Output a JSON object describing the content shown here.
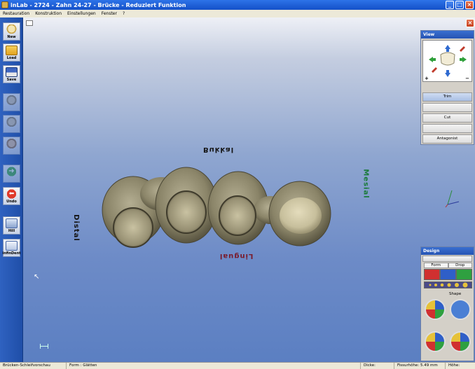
{
  "window": {
    "title": "inLab - 2724 - Zahn 24-27 - Brücke - Reduziert Funktion",
    "controls": [
      "_",
      "□",
      "×"
    ]
  },
  "menu": [
    "Restauration",
    "Konstruktion",
    "Einstellungen",
    "Fenster",
    "?"
  ],
  "toolbar": [
    {
      "label": "New",
      "icon": "tooth-new-icon"
    },
    {
      "label": "Load",
      "icon": "folder-icon"
    },
    {
      "label": "Save",
      "icon": "floppy-icon"
    },
    {
      "label": "",
      "icon": "tooth-step1-icon"
    },
    {
      "label": "",
      "icon": "tooth-step2-icon"
    },
    {
      "label": "",
      "icon": "tooth-step3-icon"
    },
    {
      "label": "",
      "icon": "arrow-right-icon"
    },
    {
      "label": "Undo",
      "icon": "undo-icon"
    },
    {
      "label": "Hill",
      "icon": "hill-icon"
    },
    {
      "label": "infinDent",
      "icon": "infinident-icon"
    }
  ],
  "viewport": {
    "labels": {
      "bukkal": "Bukkal",
      "lingual": "Lingual",
      "distal": "Distal",
      "mesial": "Mesial"
    }
  },
  "view_panel": {
    "title": "View",
    "zoom_in": "+",
    "zoom_out": "−",
    "buttons": [
      {
        "label": "Trim",
        "state": "active"
      },
      {
        "label": "",
        "state": "disabled"
      },
      {
        "label": "Cut",
        "state": "normal"
      },
      {
        "label": "",
        "state": "disabled"
      },
      {
        "label": "Antagonist",
        "state": "normal"
      }
    ]
  },
  "design_panel": {
    "title": "Design",
    "edit_label": "",
    "tool_tabs": [
      "Form",
      "Drop"
    ],
    "shape_label": "Shape"
  },
  "status": {
    "left": "Brücken-Schleifvorschau",
    "form": "Form : Glätten",
    "dicke": "Dicke:",
    "fissur": "Fissurhöhe: 5.49 mm",
    "hoehe": "Höhe:"
  },
  "colors": {
    "bukkal": "#141414",
    "lingual": "#7a1a2a",
    "distal": "#141414",
    "mesial": "#1a7a3a",
    "tooth": "#8a8468"
  }
}
